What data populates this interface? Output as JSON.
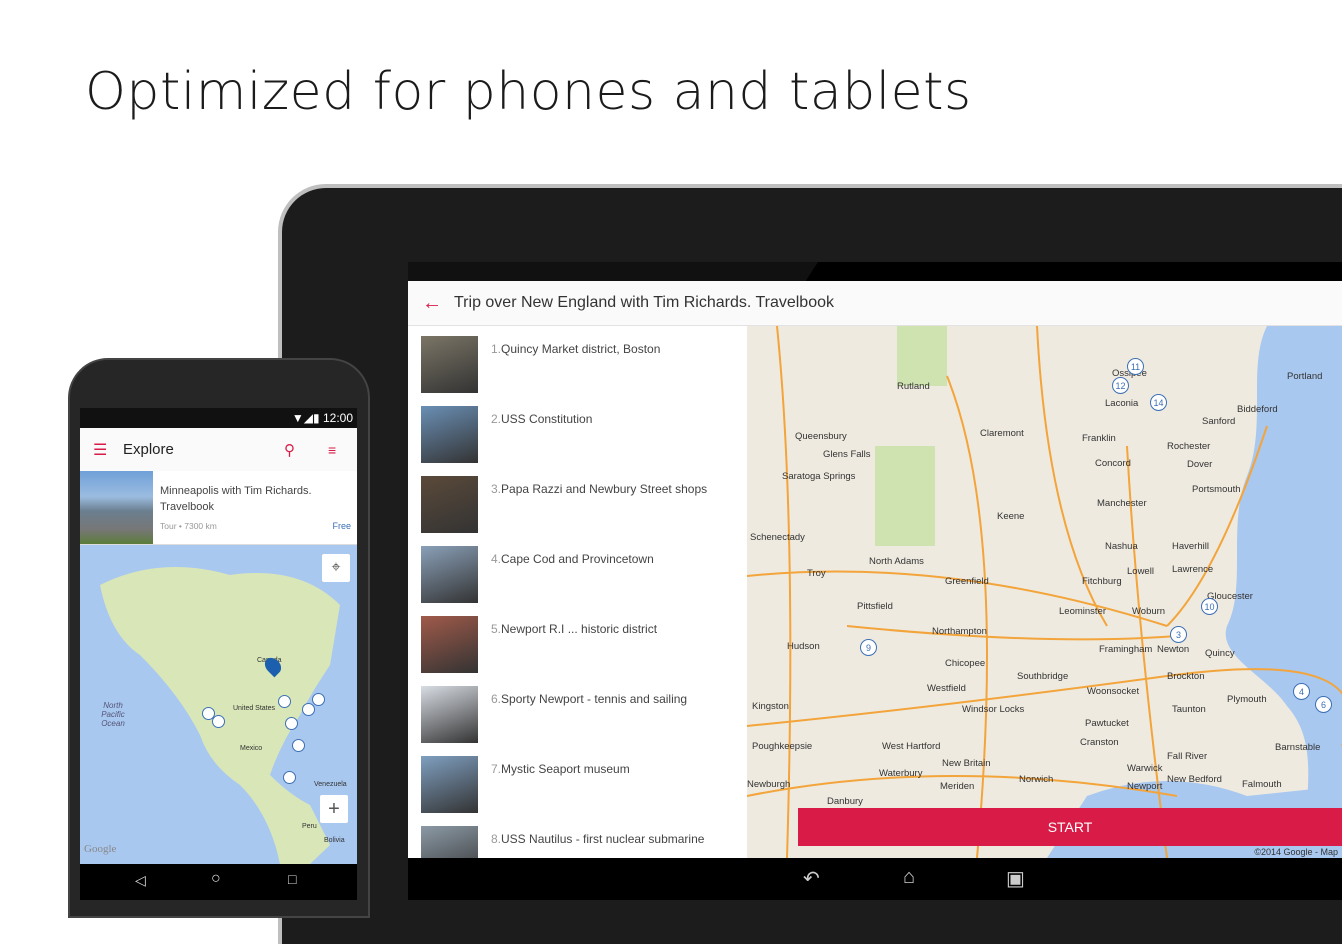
{
  "headline": "Optimized for phones and tablets",
  "colors": {
    "accent": "#d81b47",
    "marker": "#3b6fb5",
    "link": "#3b6fb5"
  },
  "tablet": {
    "title": "Trip over New England with Tim Richards. Travelbook",
    "back_icon": "arrow-left-icon",
    "items": [
      {
        "num": "1.",
        "label": "Quincy Market district, Boston"
      },
      {
        "num": "2.",
        "label": "USS Constitution"
      },
      {
        "num": "3.",
        "label": "Papa Razzi and Newbury Street shops"
      },
      {
        "num": "4.",
        "label": "Cape Cod  and Provincetown"
      },
      {
        "num": "5.",
        "label": "Newport R.I ... historic district"
      },
      {
        "num": "6.",
        "label": "Sporty Newport - tennis and sailing"
      },
      {
        "num": "7.",
        "label": "Mystic Seaport museum"
      },
      {
        "num": "8.",
        "label": "USS Nautilus - first nuclear submarine"
      }
    ],
    "map_labels": [
      "Rutland",
      "Ossipee",
      "Portland",
      "Laconia",
      "Biddeford",
      "Sanford",
      "Queensbury",
      "Claremont",
      "Franklin",
      "Rochester",
      "Glens Falls",
      "Concord",
      "Dover",
      "Saratoga Springs",
      "Portsmouth",
      "Manchester",
      "Keene",
      "Schenectady",
      "Nashua",
      "Haverhill",
      "North Adams",
      "Lowell",
      "Lawrence",
      "Troy",
      "Greenfield",
      "Fitchburg",
      "Gloucester",
      "Pittsfield",
      "Leominster",
      "Woburn",
      "Northampton",
      "Framingham",
      "Newton",
      "Quincy",
      "Hudson",
      "Chicopee",
      "Southbridge",
      "Brockton",
      "Westfield",
      "Woonsocket",
      "Plymouth",
      "Kingston",
      "Windsor Locks",
      "Taunton",
      "Pawtucket",
      "Poughkeepsie",
      "West Hartford",
      "Cranston",
      "Barnstable",
      "Waterbury",
      "New Britain",
      "Fall River",
      "Warwick",
      "Newburgh",
      "Norwich",
      "New Bedford",
      "Newport",
      "Falmouth",
      "Danbury",
      "Meriden"
    ],
    "markers": [
      "11",
      "12",
      "14",
      "9",
      "3",
      "10",
      "4",
      "6"
    ],
    "start_label": "START",
    "copyright": "©2014 Google - Map"
  },
  "phone": {
    "time": "12:00",
    "title": "Explore",
    "card": {
      "title": "Minneapolis with Tim Richards. Travelbook",
      "meta": "Tour • 7300 km",
      "price": "Free"
    },
    "map_labels": [
      "Canada",
      "United States",
      "Mexico",
      "North Pacific Ocean",
      "Venezuela",
      "Peru",
      "Bolivia"
    ],
    "google": "Google",
    "zoom_in": "+"
  }
}
